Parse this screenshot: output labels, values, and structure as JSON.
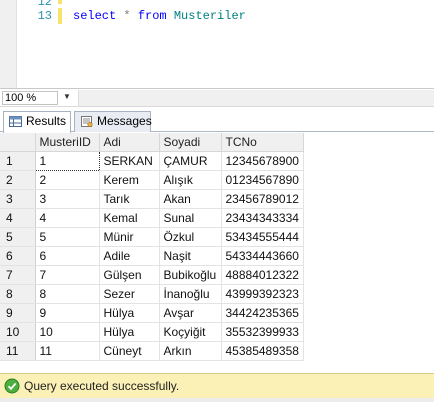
{
  "editor": {
    "lines": [
      {
        "number": "12",
        "text": ""
      },
      {
        "number": "13",
        "keyword1": "select",
        "operator": "*",
        "keyword2": "from",
        "object": "Musteriler"
      }
    ]
  },
  "zoom": {
    "value": "100 %"
  },
  "tabs": {
    "results_label": "Results",
    "messages_label": "Messages"
  },
  "grid": {
    "columns": [
      "MusteriID",
      "Adi",
      "Soyadi",
      "TCNo"
    ],
    "rows": [
      {
        "row": "1",
        "MusteriID": "1",
        "Adi": "SERKAN",
        "Soyadi": "ÇAMUR",
        "TCNo": "12345678900"
      },
      {
        "row": "2",
        "MusteriID": "2",
        "Adi": "Kerem",
        "Soyadi": "Alışık",
        "TCNo": "01234567890"
      },
      {
        "row": "3",
        "MusteriID": "3",
        "Adi": "Tarık",
        "Soyadi": "Akan",
        "TCNo": "23456789012"
      },
      {
        "row": "4",
        "MusteriID": "4",
        "Adi": "Kemal",
        "Soyadi": "Sunal",
        "TCNo": "23434343334"
      },
      {
        "row": "5",
        "MusteriID": "5",
        "Adi": "Münir",
        "Soyadi": "Özkul",
        "TCNo": "53434555444"
      },
      {
        "row": "6",
        "MusteriID": "6",
        "Adi": "Adile",
        "Soyadi": "Naşit",
        "TCNo": "54334443660"
      },
      {
        "row": "7",
        "MusteriID": "7",
        "Adi": "Gülşen",
        "Soyadi": "Bubikoğlu",
        "TCNo": "48884012322"
      },
      {
        "row": "8",
        "MusteriID": "8",
        "Adi": "Sezer",
        "Soyadi": "İnanoğlu",
        "TCNo": "43999392323"
      },
      {
        "row": "9",
        "MusteriID": "9",
        "Adi": "Hülya",
        "Soyadi": "Avşar",
        "TCNo": "34424235365"
      },
      {
        "row": "10",
        "MusteriID": "10",
        "Adi": "Hülya",
        "Soyadi": "Koçyiğit",
        "TCNo": "35532399933"
      },
      {
        "row": "11",
        "MusteriID": "11",
        "Adi": "Cüneyt",
        "Soyadi": "Arkın",
        "TCNo": "45385489358"
      }
    ]
  },
  "status": {
    "text": "Query executed successfully.",
    "icon": "check-circle-icon"
  },
  "colors": {
    "status_bg": "#fbf1b7",
    "keyword": "#0000ff",
    "object": "#008080",
    "line_number": "#2b91af"
  }
}
